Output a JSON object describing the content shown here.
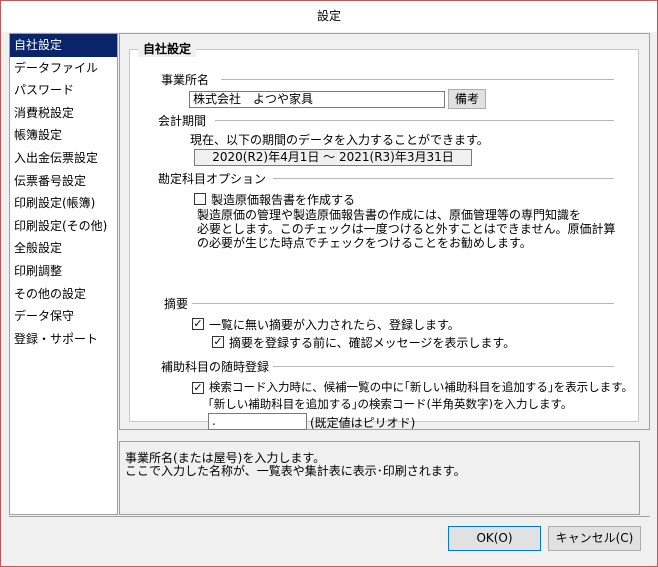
{
  "window": {
    "title": "設定"
  },
  "sidebar": {
    "items": [
      {
        "label": "自社設定",
        "selected": true
      },
      {
        "label": "データファイル"
      },
      {
        "label": "パスワード"
      },
      {
        "label": "消費税設定"
      },
      {
        "label": "帳簿設定"
      },
      {
        "label": "入出金伝票設定"
      },
      {
        "label": "伝票番号設定"
      },
      {
        "label": "印刷設定(帳簿)"
      },
      {
        "label": "印刷設定(その他)"
      },
      {
        "label": "全般設定"
      },
      {
        "label": "印刷調整"
      },
      {
        "label": "その他の設定"
      },
      {
        "label": "データ保守"
      },
      {
        "label": "登録・サポート"
      }
    ]
  },
  "main": {
    "group_title": "自社設定",
    "business": {
      "label": "事業所名",
      "value": "株式会社　よつや家具",
      "note_button": "備考"
    },
    "period": {
      "label": "会計期間",
      "description": "現在、以下の期間のデータを入力することができます。",
      "range": "2020(R2)年4月1日 ～ 2021(R3)年3月31日"
    },
    "account_options": {
      "label": "勘定科目オプション",
      "checkbox_label": "製造原価報告書を作成する",
      "checked": false,
      "desc_line1": "製造原価の管理や製造原価報告書の作成には、原価管理等の専門知識を",
      "desc_line2": "必要とします。このチェックは一度つけると外すことはできません。原価計算",
      "desc_line3": "の必要が生じた時点でチェックをつけることをお勧めします。"
    },
    "summary": {
      "label": "摘要",
      "check1_label": "一覧に無い摘要が入力されたら、登録します。",
      "check1_checked": true,
      "check2_label": "摘要を登録する前に、確認メッセージを表示します。",
      "check2_checked": true
    },
    "sub_account": {
      "label": "補助科目の随時登録",
      "check_label": "検索コード入力時に、候補一覧の中に｢新しい補助科目を追加する｣を表示します。",
      "checked": true,
      "code_desc": "｢新しい補助科目を追加する｣の検索コード(半角英数字)を入力します。",
      "code_value": ".",
      "code_default_note": "(既定値はピリオド)"
    }
  },
  "help": {
    "line1": "事業所名(または屋号)を入力します。",
    "line2": "ここで入力した名称が、一覧表や集計表に表示･印刷されます。"
  },
  "footer": {
    "ok_label": "OK(O)",
    "cancel_label": "キャンセル(C)"
  }
}
